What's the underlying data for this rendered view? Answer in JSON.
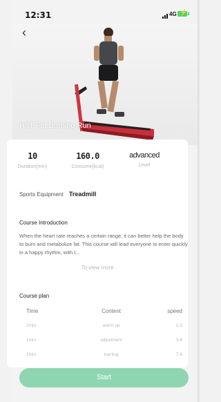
{
  "status_bar": {
    "time": "12:31",
    "network": "4G"
  },
  "workout": {
    "title": "HIIT Fat Burning Run"
  },
  "stats": [
    {
      "value": "10",
      "label": "Duration(min)"
    },
    {
      "value": "160.0",
      "label": "Consume(kcal)"
    },
    {
      "value": "advanced",
      "label": "Level"
    }
  ],
  "equipment": {
    "label": "Sports Equipment",
    "value": "Treadmill"
  },
  "intro": {
    "title": "Course Introduction",
    "text": "When the heart rate reaches a certain range, it can better help the body to burn and metabolize fat. This course will lead everyone to enter quickly in a happy rhythm, with t...",
    "view_more": "To view more"
  },
  "plan": {
    "title": "Course plan",
    "headers": [
      "Time",
      "Content",
      "speed"
    ],
    "rows": [
      [
        "2min",
        "warm up",
        "1-3"
      ],
      [
        "1min",
        "adjustment",
        "3-6"
      ],
      [
        "1min",
        "training",
        "7-9"
      ]
    ]
  },
  "start_label": "Start",
  "colors": {
    "accent": "#8ed6b2",
    "treadmill": "#d9343f"
  }
}
